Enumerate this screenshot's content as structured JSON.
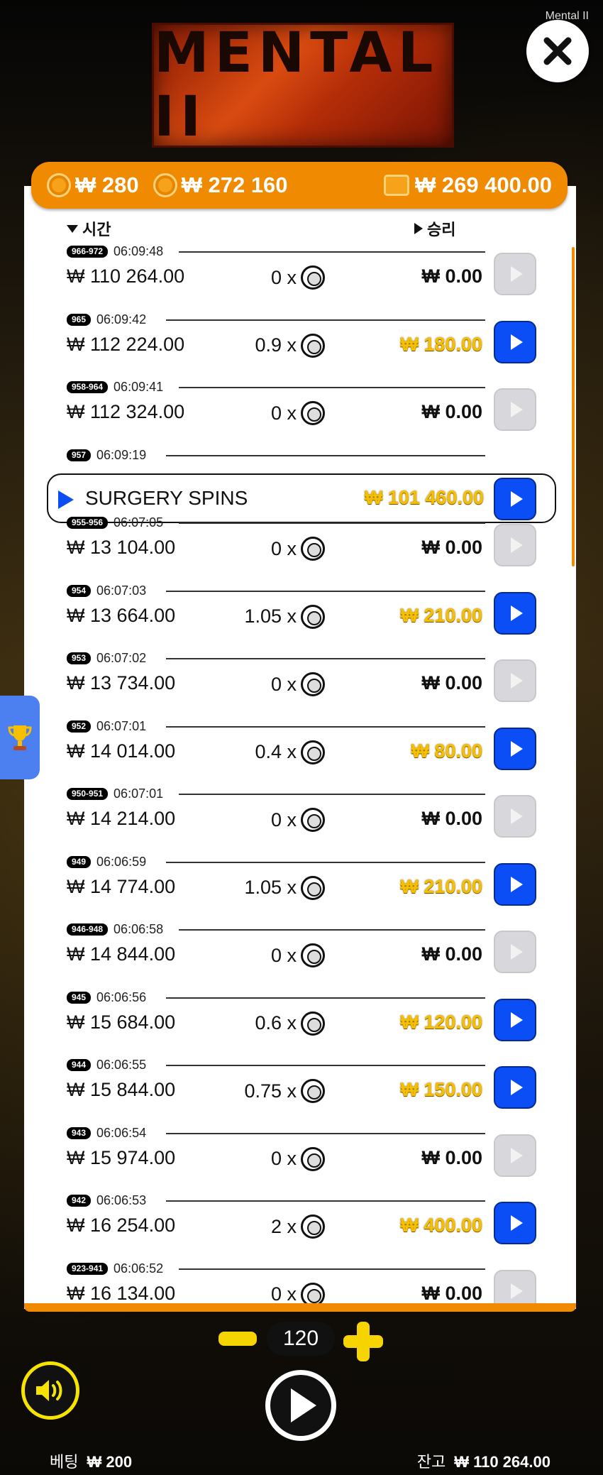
{
  "game_tag": "Mental II",
  "logo_text": "MENTAL II",
  "topbar": {
    "coins": "₩ 280",
    "total": "₩ 272 160",
    "balance": "₩ 269 400.00"
  },
  "headers": {
    "time": "시간",
    "win": "승리"
  },
  "rows": [
    {
      "id": "966-972",
      "time": "06:09:48",
      "balance": "₩ 110 264.00",
      "mult": "0 x",
      "win": "₩ 0.00",
      "active": false
    },
    {
      "id": "965",
      "time": "06:09:42",
      "balance": "₩ 112 224.00",
      "mult": "0.9 x",
      "win": "₩ 180.00",
      "active": true
    },
    {
      "id": "958-964",
      "time": "06:09:41",
      "balance": "₩ 112 324.00",
      "mult": "0 x",
      "win": "₩ 0.00",
      "active": false
    },
    {
      "id": "957",
      "time": "06:09:19",
      "special": "SURGERY SPINS",
      "win": "₩ 101 460.00",
      "active": true
    },
    {
      "id": "955-956",
      "time": "06:07:05",
      "balance": "₩ 13 104.00",
      "mult": "0 x",
      "win": "₩ 0.00",
      "active": false
    },
    {
      "id": "954",
      "time": "06:07:03",
      "balance": "₩ 13 664.00",
      "mult": "1.05 x",
      "win": "₩ 210.00",
      "active": true
    },
    {
      "id": "953",
      "time": "06:07:02",
      "balance": "₩ 13 734.00",
      "mult": "0 x",
      "win": "₩ 0.00",
      "active": false
    },
    {
      "id": "952",
      "time": "06:07:01",
      "balance": "₩ 14 014.00",
      "mult": "0.4 x",
      "win": "₩ 80.00",
      "active": true
    },
    {
      "id": "950-951",
      "time": "06:07:01",
      "balance": "₩ 14 214.00",
      "mult": "0 x",
      "win": "₩ 0.00",
      "active": false
    },
    {
      "id": "949",
      "time": "06:06:59",
      "balance": "₩ 14 774.00",
      "mult": "1.05 x",
      "win": "₩ 210.00",
      "active": true
    },
    {
      "id": "946-948",
      "time": "06:06:58",
      "balance": "₩ 14 844.00",
      "mult": "0 x",
      "win": "₩ 0.00",
      "active": false
    },
    {
      "id": "945",
      "time": "06:06:56",
      "balance": "₩ 15 684.00",
      "mult": "0.6 x",
      "win": "₩ 120.00",
      "active": true
    },
    {
      "id": "944",
      "time": "06:06:55",
      "balance": "₩ 15 844.00",
      "mult": "0.75 x",
      "win": "₩ 150.00",
      "active": true
    },
    {
      "id": "943",
      "time": "06:06:54",
      "balance": "₩ 15 974.00",
      "mult": "0 x",
      "win": "₩ 0.00",
      "active": false
    },
    {
      "id": "942",
      "time": "06:06:53",
      "balance": "₩ 16 254.00",
      "mult": "2 x",
      "win": "₩ 400.00",
      "active": true
    },
    {
      "id": "923-941",
      "time": "06:06:52",
      "balance": "₩ 16 134.00",
      "mult": "0 x",
      "win": "₩ 0.00",
      "active": false
    }
  ],
  "stake": {
    "value": "120"
  },
  "footer": {
    "bet_label": "베팅",
    "bet_value": "₩ 200",
    "balance_label": "잔고",
    "balance_value": "₩ 110 264.00"
  },
  "colors": {
    "accent": "#f08a00",
    "play_active": "#0b4ef5",
    "win_positive": "#f6c000"
  },
  "icons": {
    "close": "close-icon",
    "coin": "coin-icon",
    "wallet": "wallet-icon",
    "trophy": "trophy-icon",
    "sound": "speaker-icon",
    "spin": "play-icon"
  }
}
